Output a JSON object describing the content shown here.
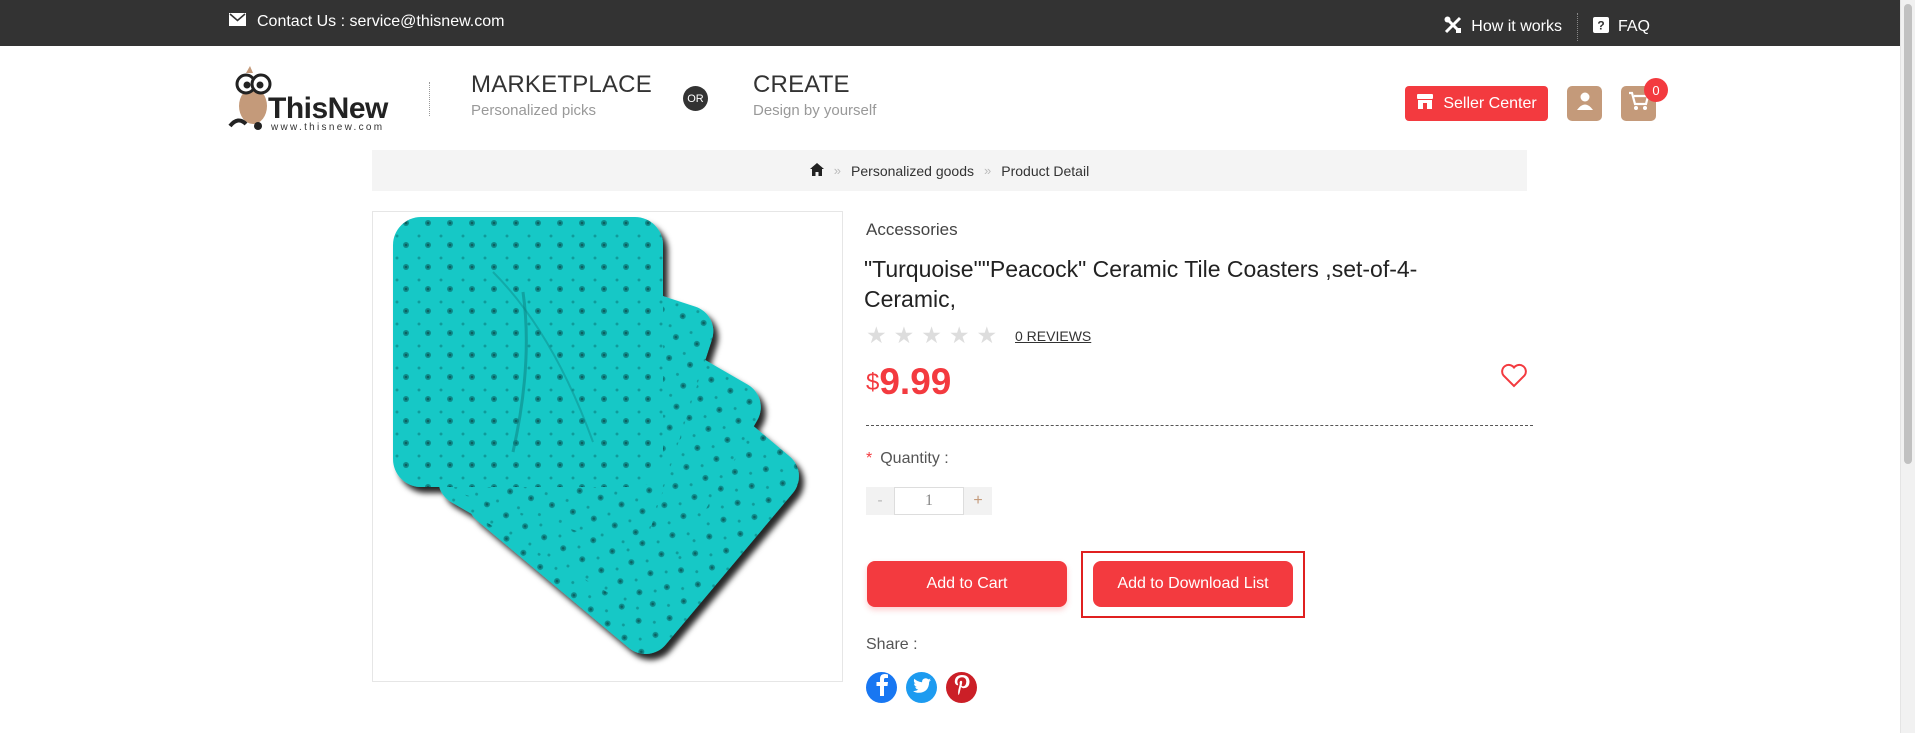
{
  "topbar": {
    "contact_text": "Contact Us : service@thisnew.com",
    "how_it_works": "How it works",
    "faq": "FAQ"
  },
  "header": {
    "logo_text": "ThisNew",
    "logo_sub": "www.thisnew.com",
    "marketplace_title": "MARKETPLACE",
    "marketplace_desc": "Personalized picks",
    "or_label": "OR",
    "create_title": "CREATE",
    "create_desc": "Design by yourself",
    "seller_center": "Seller Center",
    "cart_count": "0"
  },
  "breadcrumb": {
    "items": [
      "Personalized goods",
      "Product Detail"
    ]
  },
  "product": {
    "category": "Accessories",
    "title": "\"Turquoise\"\"Peacock\" Ceramic Tile Coasters ,set-of-4-Ceramic,",
    "rating": 0,
    "reviews": "0 REVIEWS",
    "currency": "$",
    "price": "9.99",
    "quantity_label": "Quantity :",
    "quantity_required": "*",
    "quantity_value": "1",
    "add_to_cart": "Add to Cart",
    "add_to_download": "Add to Download List",
    "share_label": "Share :"
  },
  "colors": {
    "accent": "#f33a3f",
    "topbar": "#333333",
    "tan": "#c49a7a",
    "coaster": "#17c8c6"
  }
}
